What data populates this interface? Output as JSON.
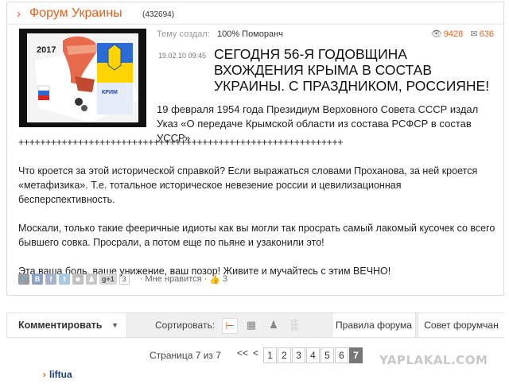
{
  "forum": {
    "title": "Форум Украины",
    "count": "(432694)"
  },
  "post": {
    "thumb_year": "2017",
    "thumb_label": "КРИМ",
    "author_label": "Тему создал:",
    "author": "100% Поморанч",
    "views": "9428",
    "comments": "636",
    "date": "19.02.10 09:45",
    "title": "СЕГОДНЯ 56-Я ГОДОВЩИНА ВХОЖДЕНИЯ КРЫМА В СОСТАВ УКРАИНЫ. С ПРАЗДНИКОМ, РОССИЯНЕ!",
    "lead": "19 февраля 1954 года Президиум Верховного Совета СССР издал Указ «О передаче Крымской области из состава РСФСР в состав УССР»",
    "separator": "++++++++++++++++++++++++++++++++++++++++++++++++++++++++++++",
    "paragraphs": [
      "Что кроется за этой исторической справкой? Если выражаться словами Проханова, за ней кроется «метафизика». Т.е. тотальное историческое невезение россии и цевилизационная бесперспективность.",
      "Москали, только такие фееричные идиоты как вы могли так просрать самый лакомый кусочек со всего бывшего совка. Просрали, а потом еще по пьяне и узаконили это!",
      "Эта ваша боль, ваше унижение, ваш позор! Живите и мучайтесь с этим ВЕЧНО!"
    ],
    "share": {
      "gplus": "g+1",
      "gplus_count": "3",
      "like_label": "· Мне нравится ·",
      "like_count": "3"
    }
  },
  "toolbar": {
    "comment_label": "Комментировать",
    "sort_label": "Сортировать:",
    "rules_label": "Правила форума",
    "advice_label": "Совет форумчан"
  },
  "pager": {
    "label": "Страница 7 из 7",
    "first": "<<",
    "prev": "<",
    "pages": [
      "1",
      "2",
      "3",
      "4",
      "5",
      "6",
      "7"
    ],
    "current": "7"
  },
  "watermark": "YAPLAKAL.COM",
  "next_user": "liftua",
  "colors": {
    "accent": "#e8601c",
    "link": "#1f3f7a"
  }
}
